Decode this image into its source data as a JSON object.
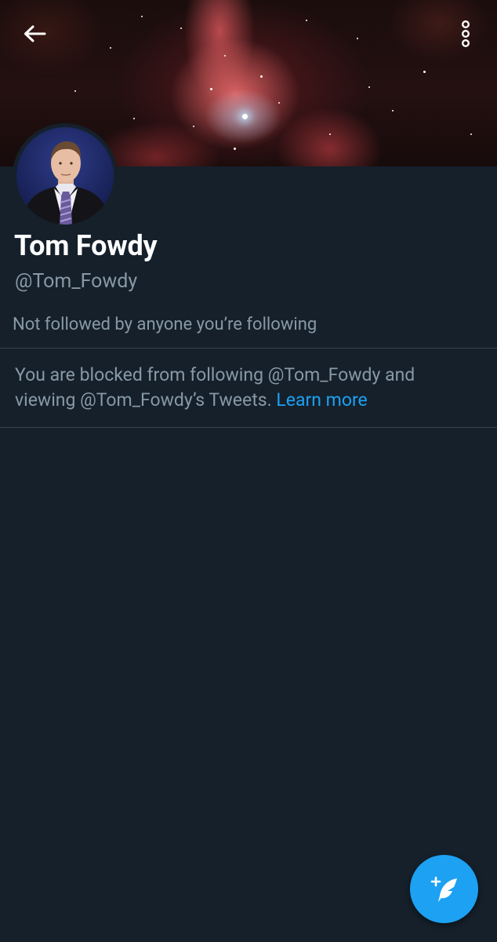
{
  "profile": {
    "display_name": "Tom Fowdy",
    "handle": "@Tom_Fowdy",
    "followed_by": "Not followed by anyone you’re following"
  },
  "blocked_notice": {
    "text": "You are blocked from following @Tom_Fowdy and viewing @Tom_Fowdy’s Tweets. ",
    "link_label": "Learn more"
  },
  "icons": {
    "back": "arrow-back-icon",
    "more": "more-vertical-icon",
    "compose": "compose-tweet-icon"
  },
  "colors": {
    "background": "#15202b",
    "primary_text": "#ffffff",
    "secondary_text": "#8899a6",
    "accent": "#1da1f2",
    "divider": "#38444d"
  }
}
